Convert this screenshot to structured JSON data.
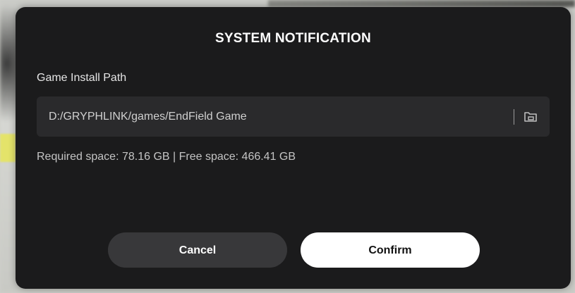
{
  "dialog": {
    "title": "SYSTEM NOTIFICATION",
    "install_path_label": "Game Install Path",
    "install_path_value": "D:/GRYPHLINK/games/EndField Game",
    "space_info": "Required space: 78.16 GB | Free space: 466.41 GB",
    "cancel_label": "Cancel",
    "confirm_label": "Confirm"
  },
  "icons": {
    "browse": "folder-icon"
  },
  "colors": {
    "dialog_bg": "#1b1b1c",
    "field_bg": "#2a2a2c",
    "cancel_bg": "#38383a",
    "confirm_bg": "#ffffff"
  }
}
